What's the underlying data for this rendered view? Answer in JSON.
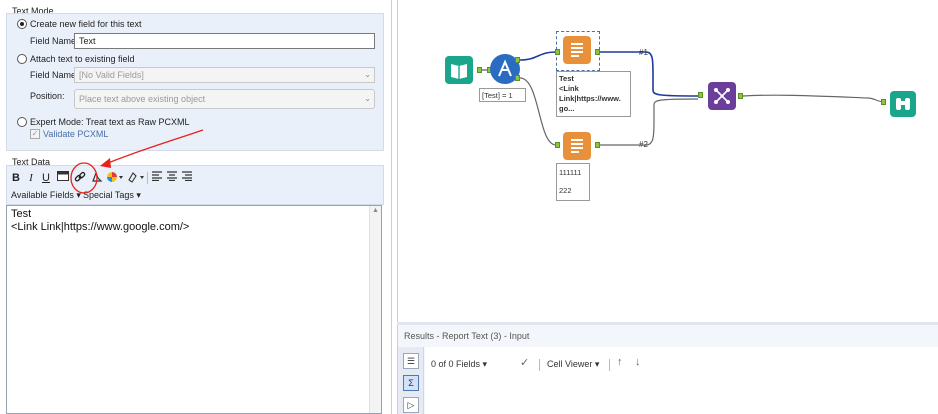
{
  "text_mode": {
    "group_title": "Text Mode",
    "option_new_field": "Create new field for this text",
    "field_name_label": "Field Name:",
    "field_name_value": "Text",
    "option_attach": "Attach text to existing field",
    "attach_field_label": "Field Name:",
    "attach_field_value": "[No Valid Fields]",
    "position_label": "Position:",
    "position_value": "Place text above existing object",
    "option_expert": "Expert Mode: Treat text as Raw PCXML",
    "validate_label": "Validate PCXML"
  },
  "text_data": {
    "group_title": "Text Data",
    "toolbar": {
      "bold": "B",
      "italic": "I",
      "underline": "U",
      "available_fields": "Available Fields",
      "special_tags": "Special Tags"
    },
    "editor_lines": [
      "Test",
      "<Link Link|https://www.google.com/>"
    ]
  },
  "canvas": {
    "filter_label": "[Test] = 1",
    "report_text_1_lines": [
      "Test",
      "<Link",
      "Link|https://www.",
      "go..."
    ],
    "report_text_2_lines": [
      "111111",
      "222"
    ],
    "connection_1": "#1",
    "connection_2": "#2"
  },
  "results": {
    "title": "Results - Report Text (3) - Input",
    "fields_count": "0 of 0 Fields",
    "cell_viewer": "Cell Viewer"
  },
  "colors": {
    "panel_bg": "#eaf0fa",
    "annotation_red": "#e8211a",
    "connection_blue": "#1f3a9e",
    "report_orange": "#e8913a",
    "join_purple": "#6a3e9a",
    "input_teal": "#1aa68a",
    "filter_blue": "#2a6cc2"
  }
}
